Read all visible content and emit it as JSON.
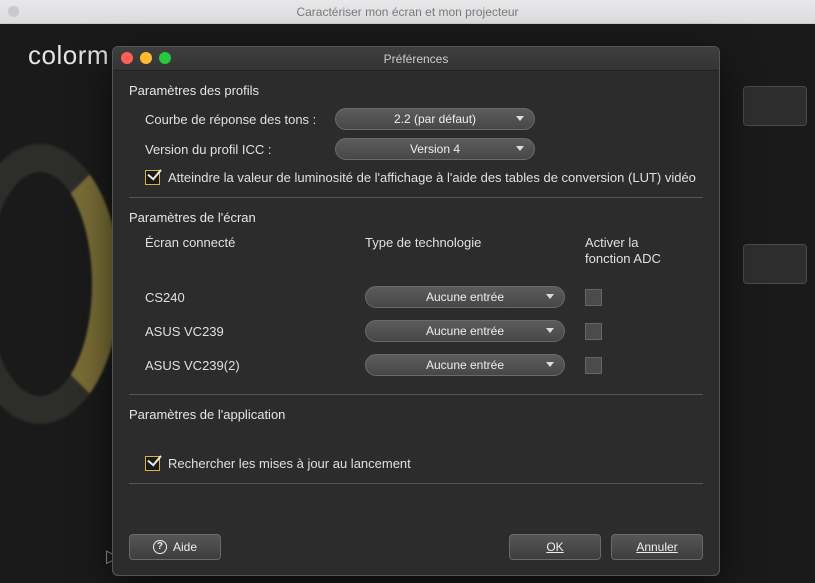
{
  "background": {
    "window_title": "Caractériser mon écran et mon projecteur",
    "logo_fragment": "colorm"
  },
  "modal": {
    "title": "Préférences",
    "profiles": {
      "section_title": "Paramètres des profils",
      "tone_curve_label": "Courbe de réponse des tons :",
      "tone_curve_value": "2.2 (par défaut)",
      "icc_label": "Version du profil ICC :",
      "icc_value": "Version 4",
      "lut_check_label": "Atteindre la valeur de luminosité de l'affichage à l'aide des tables de conversion (LUT) vidéo",
      "lut_checked": true
    },
    "displays": {
      "section_title": "Paramètres de l'écran",
      "col_connected": "Écran connecté",
      "col_tech": "Type de technologie",
      "col_adc": "Activer la fonction ADC",
      "rows": [
        {
          "name": "CS240",
          "tech": "Aucune entrée",
          "adc": false
        },
        {
          "name": "ASUS VC239",
          "tech": "Aucune entrée",
          "adc": false
        },
        {
          "name": "ASUS VC239(2)",
          "tech": "Aucune entrée",
          "adc": false
        }
      ]
    },
    "app": {
      "section_title": "Paramètres de l'application",
      "updates_label": "Rechercher les mises à jour au lancement",
      "updates_checked": true
    },
    "buttons": {
      "help": "Aide",
      "ok": "OK",
      "cancel": "Annuler"
    }
  }
}
